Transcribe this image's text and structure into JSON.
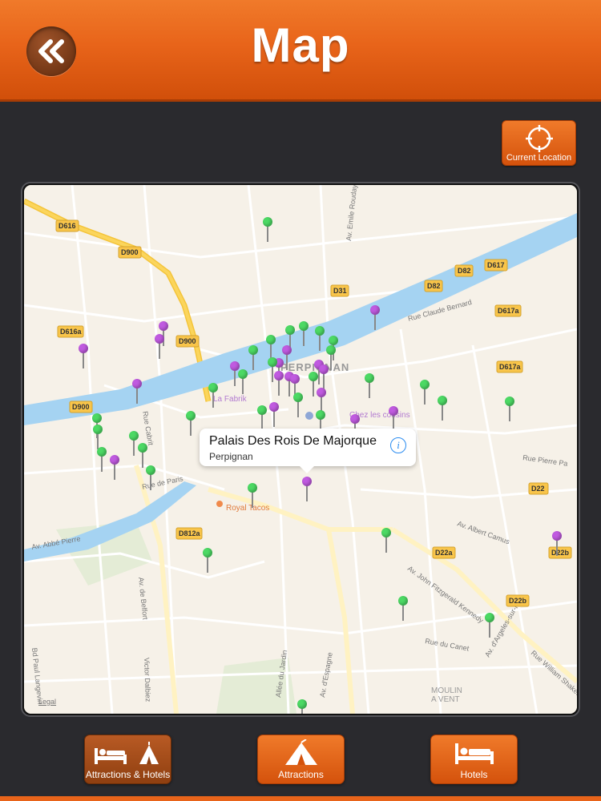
{
  "header": {
    "title": "Map",
    "back_icon": "double-chevron-left-icon"
  },
  "current_location": {
    "label": "Current Location",
    "icon": "crosshair-icon"
  },
  "map": {
    "callout": {
      "title": "Palais Des Rois De Majorque",
      "subtitle": "Perpignan"
    },
    "legal": "Legal",
    "city_label": "PERPIGNAN",
    "places": [
      "La Fabrik",
      "Chez les cousins",
      "Royal Tacos",
      "MOULIN",
      "A VENT"
    ],
    "road_shields": [
      "D616",
      "D900",
      "D31",
      "D82",
      "D617",
      "D617a",
      "D616a",
      "D900",
      "D900",
      "D617a",
      "D22",
      "D22a",
      "D22b",
      "D22b",
      "D812a"
    ],
    "street_names": [
      "Av. Emile Roudayre",
      "Rue Claude Bernard",
      "Rue Pierre Pa",
      "Av. John Fitzgerald Kennedy",
      "Rue du Canet",
      "Av. d'Argeles-sur-M",
      "Rue William Shakespea",
      "Av. Abbé Pierre",
      "Av. de Belfort",
      "Bd Paul Langevin",
      "Victor Dalbiez",
      "Rue Cabrit",
      "Av. d'Espagne",
      "Allée du Jardin",
      "Rue de Paris",
      "Av. Albert Camus"
    ],
    "pin_colors": {
      "attraction": "#4cd964",
      "hotel": "#c05ae0"
    }
  },
  "tabs": [
    {
      "label": "Attractions & Hotels",
      "icon": "bed-and-tent-icon",
      "selected": true
    },
    {
      "label": "Attractions",
      "icon": "tent-icon",
      "selected": false
    },
    {
      "label": "Hotels",
      "icon": "bed-icon",
      "selected": false
    }
  ],
  "theme": {
    "accent": "#e8641a",
    "background": "#2a2a2e"
  }
}
